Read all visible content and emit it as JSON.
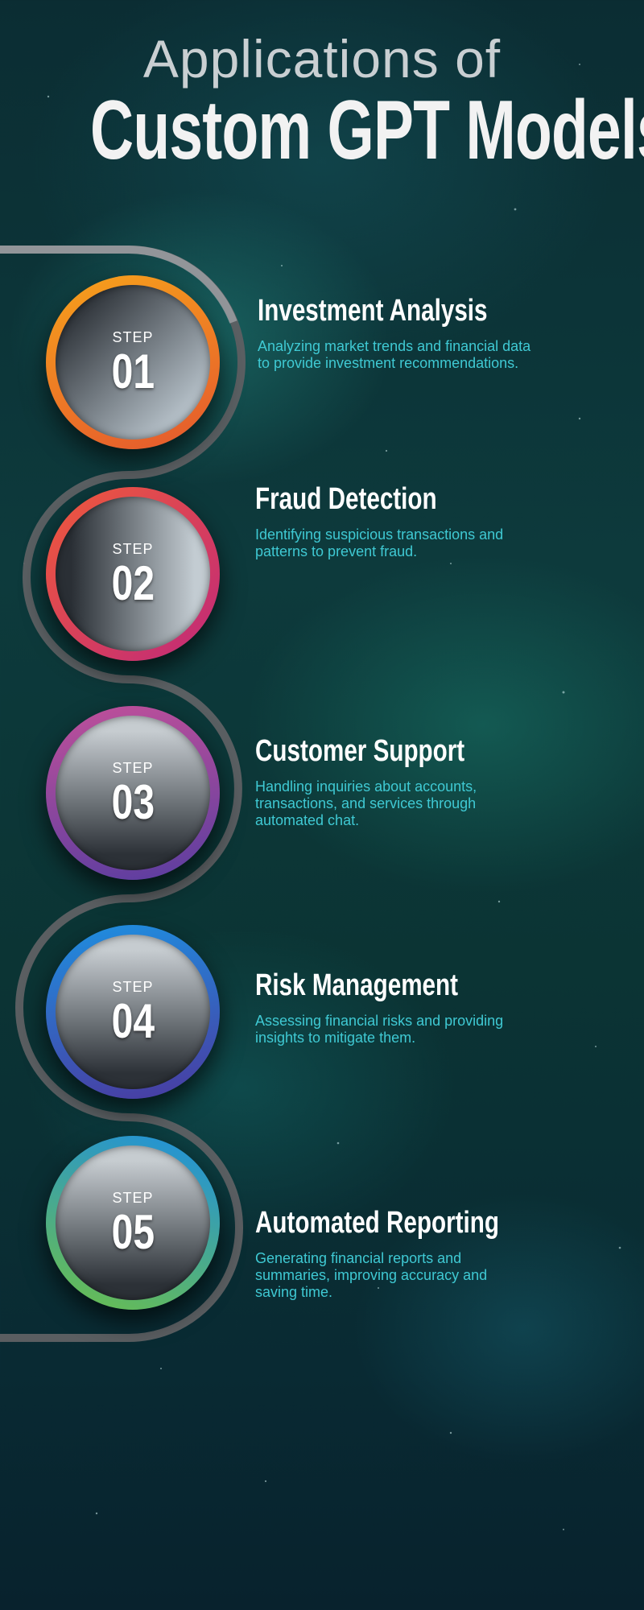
{
  "header": {
    "title_line1": "Applications of",
    "title_line2": "Custom GPT Models"
  },
  "colors": {
    "description_text": "#3fc9d3",
    "title_text": "#ffffff",
    "path_stroke": "#5f6164"
  },
  "steps": [
    {
      "label": "STEP",
      "number": "01",
      "title": "Investment Analysis",
      "description": "Analyzing market trends and financial data to provide investment recommendations.",
      "ring_colors": [
        "#f7a21b",
        "#e4572e"
      ]
    },
    {
      "label": "STEP",
      "number": "02",
      "title": "Fraud Detection",
      "description": "Identifying suspicious transactions and patterns to prevent fraud.",
      "ring_colors": [
        "#f05a3a",
        "#c0287a"
      ]
    },
    {
      "label": "STEP",
      "number": "03",
      "title": "Customer Support",
      "description": "Handling inquiries about accounts, transactions, and services through automated chat.",
      "ring_colors": [
        "#c0509a",
        "#5a3da0"
      ]
    },
    {
      "label": "STEP",
      "number": "04",
      "title": "Risk Management",
      "description": "Assessing financial risks and providing insights to mitigate them.",
      "ring_colors": [
        "#1e8fe0",
        "#4a3aa0"
      ]
    },
    {
      "label": "STEP",
      "number": "05",
      "title": "Automated Reporting",
      "description": "Generating financial reports and summaries, improving accuracy and saving time.",
      "ring_colors": [
        "#1e8fe0",
        "#6cc04a"
      ]
    }
  ]
}
